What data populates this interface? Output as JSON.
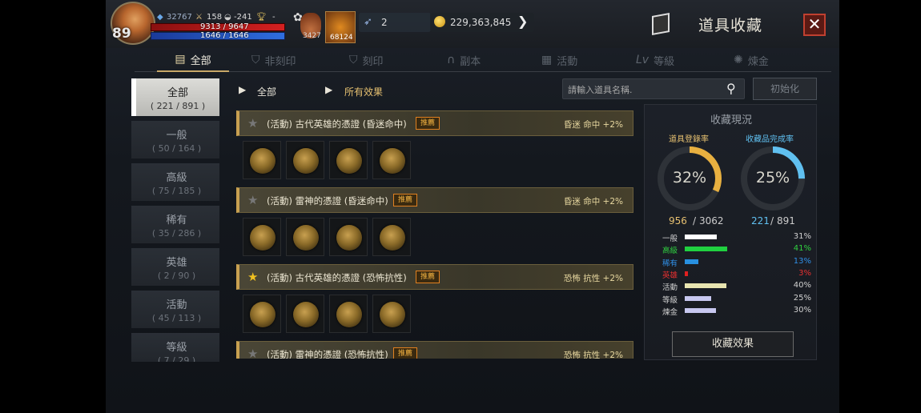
{
  "player": {
    "level": "89",
    "combat_power": "32767",
    "stat_a": "158",
    "stat_b": "-241",
    "stat_c": "-",
    "hp": "9313 / 9647",
    "mp": "1646 / 1646",
    "potion_count": "3427",
    "skill_count": "68124",
    "feather": "2",
    "gold": "229,363,845"
  },
  "header": {
    "title": "道具收藏"
  },
  "tabs": [
    {
      "label": "全部",
      "icon": "scroll-icon"
    },
    {
      "label": "非刻印",
      "icon": "shield-icon"
    },
    {
      "label": "刻印",
      "icon": "shield-icon"
    },
    {
      "label": "副本",
      "icon": "helmet-icon"
    },
    {
      "label": "活動",
      "icon": "gift-icon"
    },
    {
      "label": "等級",
      "icon": "lv-icon"
    },
    {
      "label": "煉金",
      "icon": "gear-icon"
    }
  ],
  "categories": [
    {
      "name": "全部",
      "count": "( 221 / 891 )"
    },
    {
      "name": "一般",
      "count": "( 50 / 164 )"
    },
    {
      "name": "高級",
      "count": "( 75 / 185 )"
    },
    {
      "name": "稀有",
      "count": "( 35 / 286 )"
    },
    {
      "name": "英雄",
      "count": "( 2 / 90 )"
    },
    {
      "name": "活動",
      "count": "( 45 / 113 )"
    },
    {
      "name": "等級",
      "count": "( 7 / 29 )"
    }
  ],
  "breadcrumb": {
    "first": "全部",
    "second": "所有效果"
  },
  "search": {
    "placeholder": "請輸入道具名稱."
  },
  "reset_label": "初始化",
  "items": [
    {
      "name": "(活動) 古代英雄的憑證 (昏迷命中)",
      "badge": "推薦",
      "effect": "昏迷 命中 +2%",
      "starred": false
    },
    {
      "name": "(活動) 雷神的憑證 (昏迷命中)",
      "badge": "推薦",
      "effect": "昏迷 命中 +2%",
      "starred": false
    },
    {
      "name": "(活動) 古代英雄的憑證 (恐怖抗性)",
      "badge": "推薦",
      "effect": "恐怖 抗性 +2%",
      "starred": true
    },
    {
      "name": "(活動) 雷神的憑證 (恐怖抗性)",
      "badge": "推薦",
      "effect": "恐怖 抗性 +2%",
      "starred": false
    }
  ],
  "panel": {
    "title": "收藏現況",
    "ring1": {
      "label": "道具登錄率",
      "value": "32%",
      "fraction": 0.32,
      "num_a": "956",
      "num_b": "3062",
      "color": "#e8b040"
    },
    "ring2": {
      "label": "收藏品完成率",
      "value": "25%",
      "fraction": 0.25,
      "num_a": "221",
      "num_b": "891",
      "color": "#60c0f0"
    },
    "legend": [
      {
        "name": "一般",
        "percent": "31%",
        "fraction": 0.31,
        "color": "#ffffff",
        "text_color": "#d0d0d0"
      },
      {
        "name": "高級",
        "percent": "41%",
        "fraction": 0.41,
        "color": "#20d040",
        "text_color": "#30d040"
      },
      {
        "name": "稀有",
        "percent": "13%",
        "fraction": 0.13,
        "color": "#2890e0",
        "text_color": "#3090e8"
      },
      {
        "name": "英雄",
        "percent": "3%",
        "fraction": 0.03,
        "color": "#e02020",
        "text_color": "#e83030"
      },
      {
        "name": "活動",
        "percent": "40%",
        "fraction": 0.4,
        "color": "#e8e4b0",
        "text_color": "#d0d0d0"
      },
      {
        "name": "等級",
        "percent": "25%",
        "fraction": 0.25,
        "color": "#c8c8f0",
        "text_color": "#d0d0d0"
      },
      {
        "name": "煉金",
        "percent": "30%",
        "fraction": 0.3,
        "color": "#c8c8f0",
        "text_color": "#d0d0d0"
      }
    ],
    "effect_button": "收藏效果"
  }
}
